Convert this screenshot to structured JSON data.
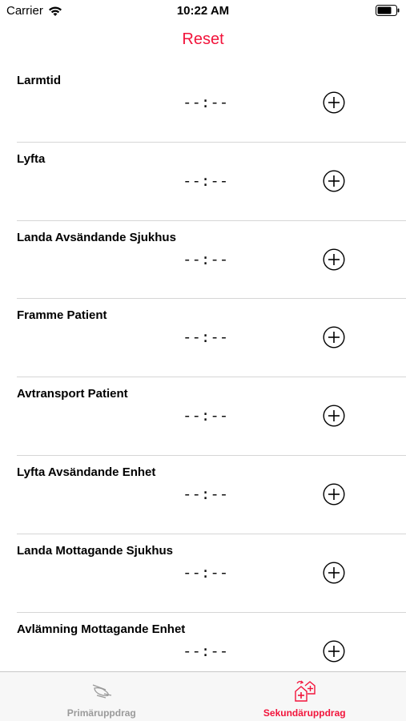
{
  "status_bar": {
    "carrier": "Carrier",
    "time": "10:22 AM"
  },
  "nav": {
    "reset_label": "Reset",
    "accent_color": "#f2143b"
  },
  "rows": [
    {
      "title": "Larmtid",
      "time": "--:--"
    },
    {
      "title": "Lyfta",
      "time": "--:--"
    },
    {
      "title": "Landa Avsändande Sjukhus",
      "time": "--:--"
    },
    {
      "title": "Framme Patient",
      "time": "--:--"
    },
    {
      "title": "Avtransport Patient",
      "time": "--:--"
    },
    {
      "title": "Lyfta Avsändande Enhet",
      "time": "--:--"
    },
    {
      "title": "Landa Mottagande Sjukhus",
      "time": "--:--"
    },
    {
      "title": "Avlämning Mottagande Enhet",
      "time": "--:--"
    }
  ],
  "tabs": [
    {
      "label": "Primäruppdrag",
      "icon": "helicopter-icon",
      "selected": false
    },
    {
      "label": "Sekundäruppdrag",
      "icon": "hospital-transfer-icon",
      "selected": true
    }
  ]
}
